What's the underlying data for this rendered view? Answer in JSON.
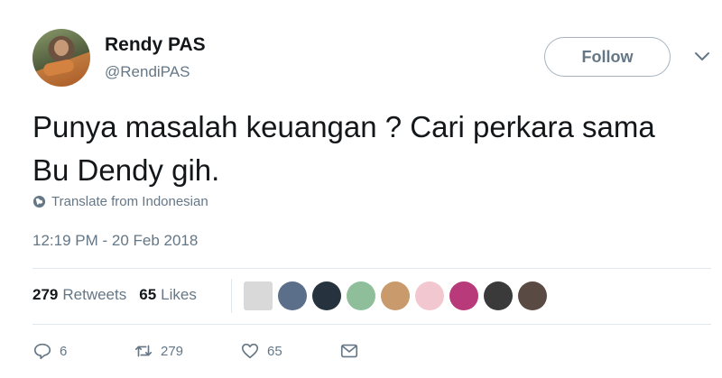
{
  "user": {
    "display_name": "Rendy PAS",
    "handle": "@RendiPAS"
  },
  "follow_button": "Follow",
  "tweet": {
    "text": "Punya masalah keuangan ? Cari perkara sama Bu Dendy gih.",
    "translate_label": "Translate from Indonesian",
    "timestamp": "12:19 PM - 20 Feb 2018"
  },
  "stats": {
    "retweets_count": "279",
    "retweets_label": "Retweets",
    "likes_count": "65",
    "likes_label": "Likes"
  },
  "liker_avatars": [
    {
      "color": "#d9d9d9"
    },
    {
      "color": "#5b6f8a"
    },
    {
      "color": "#26323e"
    },
    {
      "color": "#8fbf9a"
    },
    {
      "color": "#c99a6b"
    },
    {
      "color": "#f2c7cf"
    },
    {
      "color": "#b83a7a"
    },
    {
      "color": "#3a3a3a"
    },
    {
      "color": "#5a4a44"
    }
  ],
  "actions": {
    "reply_count": "6",
    "retweet_count": "279",
    "like_count": "65"
  },
  "colors": {
    "text_primary": "#14171a",
    "text_secondary": "#657786",
    "divider": "#e1e8ed",
    "follow_border": "#a6b3bf"
  },
  "icons": [
    "globe-icon",
    "chevron-down-icon",
    "reply-icon",
    "retweet-icon",
    "heart-icon",
    "envelope-icon"
  ]
}
